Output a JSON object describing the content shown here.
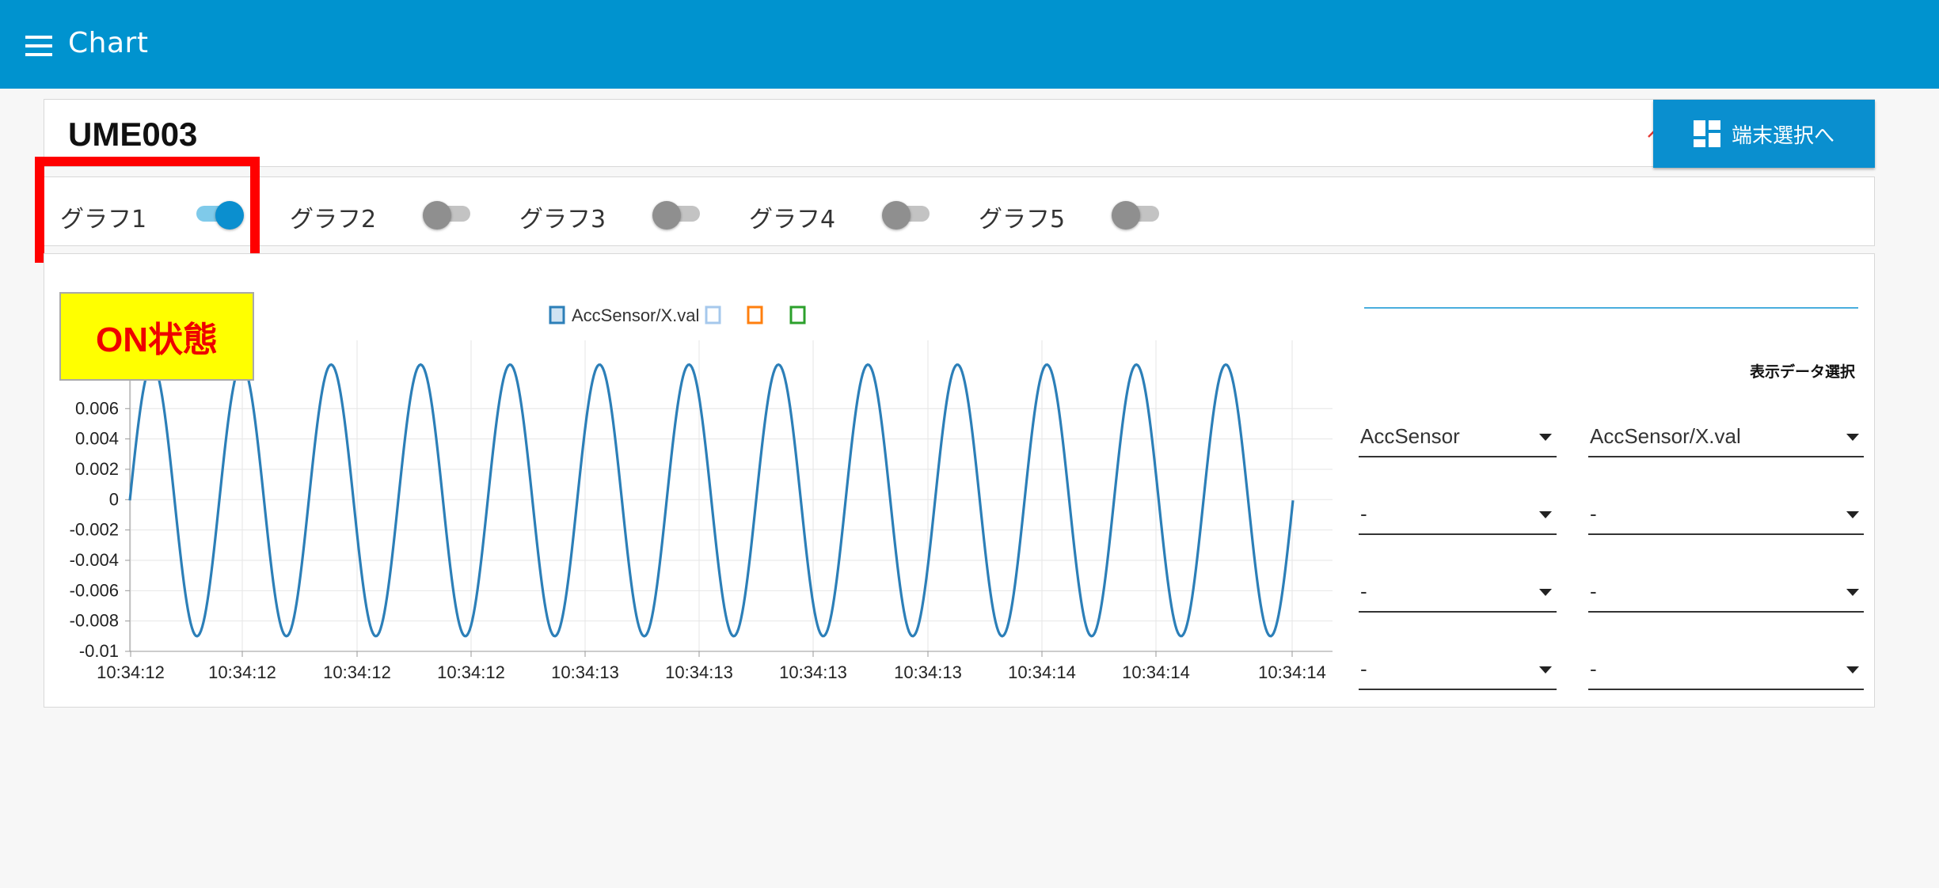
{
  "appbar": {
    "title": "Chart",
    "menu_icon": "menu-icon"
  },
  "header": {
    "device_name": "UME003",
    "collapse_icon": "chevron-up-icon",
    "device_select_label": "端末選択へ",
    "device_select_icon": "dashboard-icon"
  },
  "graph_toggles": [
    {
      "label": "グラフ1",
      "on": true
    },
    {
      "label": "グラフ2",
      "on": false
    },
    {
      "label": "グラフ3",
      "on": false
    },
    {
      "label": "グラフ4",
      "on": false
    },
    {
      "label": "グラフ5",
      "on": false
    }
  ],
  "annotation": {
    "text": "ON状態"
  },
  "side_panel": {
    "caption": "表示データ選択",
    "rows": [
      {
        "left": "AccSensor",
        "right": "AccSensor/X.val"
      },
      {
        "left": "-",
        "right": "-"
      },
      {
        "left": "-",
        "right": "-"
      },
      {
        "left": "-",
        "right": "-"
      }
    ]
  },
  "colors": {
    "appbar": "#0093cf",
    "accent": "#0a8fcf",
    "series": "#2c7fb8",
    "annotation_box": "#ff0000",
    "annotation_bg": "#ffff00",
    "legend_2": "#a6c8ec",
    "legend_3": "#ff7f0e",
    "legend_4": "#2ca02c"
  },
  "chart_data": {
    "type": "line",
    "legend": [
      "AccSensor/X.val",
      "",
      "",
      ""
    ],
    "legend_placement": "top-center",
    "grid": true,
    "y_ticks": [
      "0.006",
      "0.004",
      "0.002",
      "0",
      "-0.002",
      "-0.004",
      "-0.006",
      "-0.008",
      "-0.01"
    ],
    "x_ticks": [
      "10:34:12",
      "10:34:12",
      "10:34:12",
      "10:34:12",
      "10:34:13",
      "10:34:13",
      "10:34:13",
      "10:34:13",
      "10:34:14",
      "10:34:14",
      "10:34:14"
    ],
    "ylim": [
      -0.01,
      0.0105
    ],
    "series": [
      {
        "name": "AccSensor/X.val",
        "waveform": "sine",
        "cycles": 13,
        "min": -0.009,
        "max": 0.0089,
        "start_value": 0
      }
    ]
  }
}
